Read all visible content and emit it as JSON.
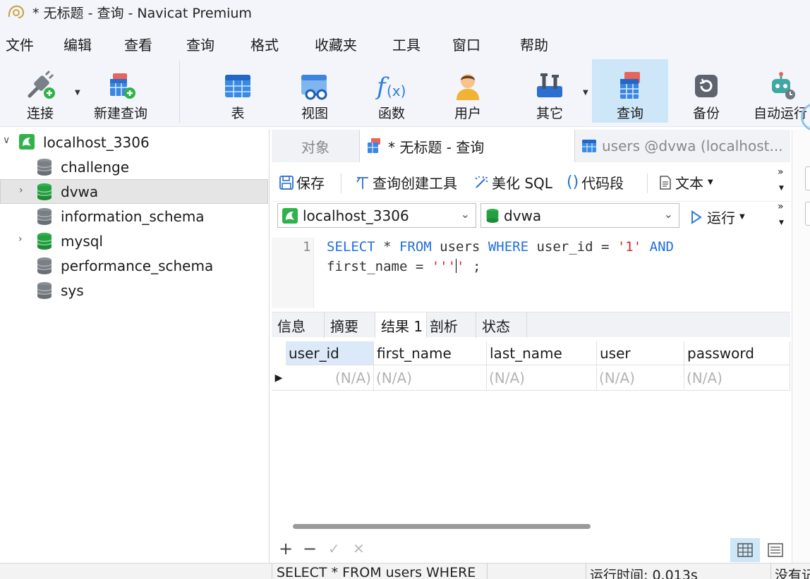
{
  "window": {
    "title": "* 无标题 - 查询 - Navicat Premium"
  },
  "menu": [
    "文件",
    "编辑",
    "查看",
    "查询",
    "格式",
    "收藏夹",
    "工具",
    "窗口",
    "帮助"
  ],
  "toolbar": {
    "connect": "连接",
    "new_query": "新建查询",
    "table": "表",
    "view": "视图",
    "function": "函数",
    "user": "用户",
    "other": "其它",
    "query": "查询",
    "backup": "备份",
    "automation": "自动运行"
  },
  "tree": {
    "connection": "localhost_3306",
    "databases": [
      "challenge",
      "dvwa",
      "information_schema",
      "mysql",
      "performance_schema",
      "sys"
    ]
  },
  "tabs": {
    "objects": "对象",
    "query_tab": "* 无标题 - 查询",
    "users_tab": "users @dvwa (localhost..."
  },
  "query_toolbar": {
    "save": "保存",
    "builder": "查询创建工具",
    "beautify": "美化 SQL",
    "snippet": "代码段",
    "text": "文本",
    "run": "运行"
  },
  "selectors": {
    "connection": "localhost_3306",
    "database": "dvwa"
  },
  "editor": {
    "line_number": "1",
    "line1": {
      "kw1": "SELECT",
      "p1": " * ",
      "kw2": "FROM",
      "p2": " users ",
      "kw3": "WHERE",
      "p3": " user_id = ",
      "s1": "'1'",
      "p4": " ",
      "kw4": "AND"
    },
    "line2": {
      "p1": "first_name = ",
      "s1": "'''",
      "s2": "'",
      "p2": " ;"
    }
  },
  "result_tabs": [
    "信息",
    "摘要",
    "结果 1",
    "剖析",
    "状态"
  ],
  "grid": {
    "columns": [
      "user_id",
      "first_name",
      "last_name",
      "user",
      "password"
    ],
    "row": [
      "(N/A)",
      "(N/A)",
      "(N/A)",
      "(N/A)",
      "(N/A)"
    ]
  },
  "status": {
    "sql": "SELECT * FROM users WHERE",
    "runtime": "运行时间: 0.013s",
    "extra": "没有记"
  }
}
